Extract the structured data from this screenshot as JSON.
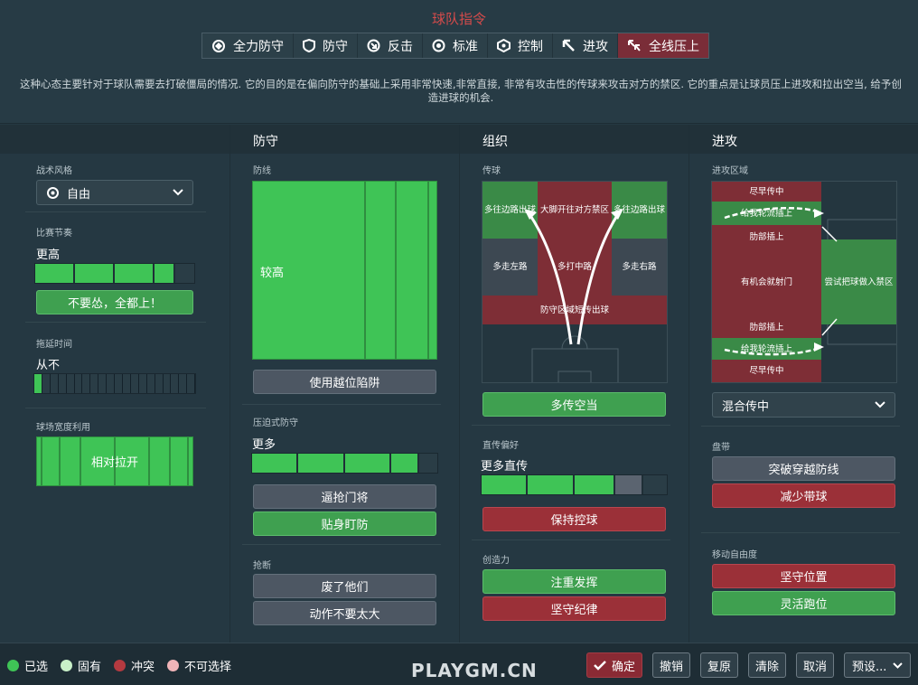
{
  "header": {
    "title": "球队指令",
    "description": "这种心态主要针对于球队需要去打破僵局的情况. 它的目的是在偏向防守的基础上采用非常快速,非常直接, 非常有攻击性的传球来攻击对方的禁区. 它的重点是让球员压上进攻和拉出空当, 给予创造进球的机会."
  },
  "tabs": [
    {
      "label": "全力防守"
    },
    {
      "label": "防守"
    },
    {
      "label": "反击"
    },
    {
      "label": "标准"
    },
    {
      "label": "控制"
    },
    {
      "label": "进攻"
    },
    {
      "label": "全线压上"
    }
  ],
  "columns": {
    "defense": "防守",
    "organize": "组织",
    "attack": "进攻"
  },
  "left": {
    "style_label": "战术风格",
    "style_value": "自由",
    "tempo_label": "比赛节奏",
    "tempo_value": "更高",
    "tempo_level": 0.88,
    "tempo_button": "不要怂，全都上！",
    "delay_label": "拖延时间",
    "delay_value": "从不",
    "delay_level": 0.05,
    "width_label": "球场宽度利用",
    "width_value": "相对拉开"
  },
  "defense": {
    "line_label": "防线",
    "line_value": "较高",
    "offside_button": "使用越位陷阱",
    "press_label": "压迫式防守",
    "press_value": "更多",
    "press_level": 0.9,
    "press_btn1": "逼抢门将",
    "press_btn2": "贴身盯防",
    "tackle_label": "抢断",
    "tackle_btn1": "废了他们",
    "tackle_btn2": "动作不要太大"
  },
  "organize": {
    "pass_label": "传球",
    "pitch": {
      "left_wing": "多往边路出球",
      "center_long": "大脚开往对方禁区",
      "right_wing": "多往边路出球",
      "left_mid": "多走左路",
      "center_mid": "多打中路",
      "right_mid": "多走右路",
      "back": "防守区域短传出球"
    },
    "space_button": "多传空当",
    "direct_label": "直传偏好",
    "direct_value": "更多直传",
    "direct_level": 0.72,
    "possession_button": "保持控球",
    "create_label": "创造力",
    "create_btn1": "注重发挥",
    "create_btn2": "坚守纪律"
  },
  "attack": {
    "zone_label": "进攻区域",
    "pitch": {
      "early1": "尽早传中",
      "overlap1": "给我轮流插上",
      "half1": "肋部插上",
      "shoot": "有机会就射门",
      "work_in": "尝试把球做入禁区",
      "half2": "肋部插上",
      "overlap2": "给我轮流插上",
      "early2": "尽早传中"
    },
    "cross_value": "混合传中",
    "dribble_label": "盘带",
    "dribble_btn1": "突破穿越防线",
    "dribble_btn2": "减少带球",
    "free_label": "移动自由度",
    "free_btn1": "坚守位置",
    "free_btn2": "灵活跑位"
  },
  "footer": {
    "legend": [
      {
        "label": "已选",
        "color": "#3fc456"
      },
      {
        "label": "固有",
        "color": "#c8f0c8"
      },
      {
        "label": "冲突",
        "color": "#b43a40"
      },
      {
        "label": "不可选择",
        "color": "#f0b4b8"
      }
    ],
    "watermark": "PLAYGM.CN",
    "confirm": "确定",
    "undo": "撤销",
    "redo": "复原",
    "clear": "清除",
    "cancel": "取消",
    "preset": "预设..."
  }
}
